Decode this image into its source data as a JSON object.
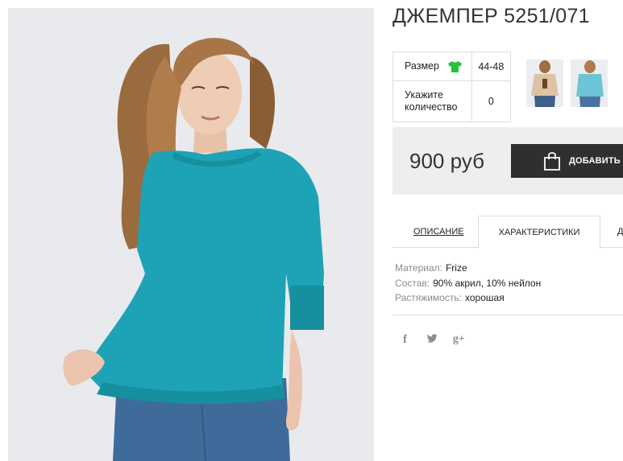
{
  "product": {
    "title": "ДЖЕМПЕР 5251/071",
    "options": [
      {
        "label": "Размер",
        "value": "44-48",
        "icon": "green-shirt-icon"
      },
      {
        "label": "Укажите количество",
        "value": "0"
      }
    ],
    "thumbnails": [
      "beige-blouse-thumbnail",
      "turquoise-sweater-thumbnail"
    ],
    "price": "900 руб",
    "add_to_cart": "ДОБАВИТЬ В"
  },
  "tabs": [
    {
      "label": "ОПИСАНИЕ",
      "active": false
    },
    {
      "label": "ХАРАКТЕРИСТИКИ",
      "active": true
    },
    {
      "label": "Д",
      "active": false
    }
  ],
  "characteristics": [
    {
      "key": "Материал:",
      "value": "Frize"
    },
    {
      "key": "Состав:",
      "value": "90% акрил, 10% нейлон"
    },
    {
      "key": "Растяжимость:",
      "value": "хорошая"
    }
  ],
  "social": {
    "facebook": "f",
    "twitter": "twitter-icon",
    "google_plus": "g+"
  },
  "colors": {
    "sweater": "#1da3b5",
    "cart_button": "#2f2f2f",
    "price_bar": "#eeeeee",
    "size_icon": "#27c23a"
  }
}
